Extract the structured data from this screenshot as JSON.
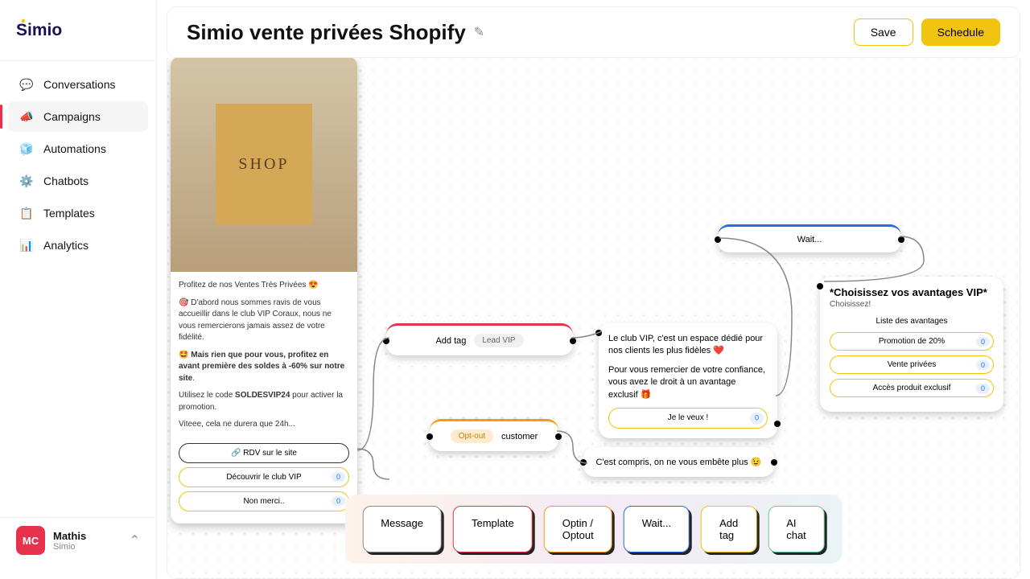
{
  "logo_text": "Simio",
  "nav": [
    {
      "label": "Conversations"
    },
    {
      "label": "Campaigns"
    },
    {
      "label": "Automations"
    },
    {
      "label": "Chatbots"
    },
    {
      "label": "Templates"
    },
    {
      "label": "Analytics"
    }
  ],
  "user": {
    "initials": "MC",
    "name": "Mathis",
    "org": "Simio"
  },
  "header": {
    "title": "Simio vente privées Shopify",
    "save": "Save",
    "schedule": "Schedule"
  },
  "msg": {
    "bag": "SHOP",
    "p1": "Profitez de nos Ventes Très Privées 😍",
    "p2": "🎯 D'abord nous sommes ravis de vous accueillir dans le club VIP Coraux, nous ne vous remercierons jamais assez de votre fidélité.",
    "p3a": "🤩 ",
    "p3b": "Mais rien que pour vous, profitez en avant première des soldes à -60% sur notre site",
    "p3c": ".",
    "p4a": "Utilisez le code ",
    "p4b": "SOLDESVIP24",
    "p4c": " pour activer la promotion.",
    "p5": "Viteee, cela ne durera que 24h...",
    "b1": "🔗 RDV sur le site",
    "b2": "Découvrir le club VIP",
    "b3": "Non merci..",
    "count": "0"
  },
  "tagnode": {
    "label": "Add tag",
    "pill": "Lead VIP"
  },
  "optout": {
    "pill": "Opt-out",
    "role": "customer"
  },
  "club": {
    "p1": "Le club VIP, c'est un espace dédié pour nos clients les plus fidèles ❤️",
    "p2": "Pour vous remercier de votre confiance, vous avez le droit à un avantage exclusif 🎁",
    "btn": "Je le veux !",
    "count": "0"
  },
  "wait": {
    "label": "Wait..."
  },
  "vip": {
    "title": "*Choisissez vos avantages VIP*",
    "sub": "Choisissez!",
    "list_label": "Liste des avantages",
    "o1": "Promotion de 20%",
    "o2": "Vente privées",
    "o3": "Accès produit exclusif",
    "count": "0"
  },
  "compris": {
    "text": "C'est compris, on ne vous embête plus 😉"
  },
  "toolbar": {
    "message": "Message",
    "template": "Template",
    "optin": "Optin / Optout",
    "wait": "Wait...",
    "addtag": "Add tag",
    "aichat": "AI chat"
  }
}
